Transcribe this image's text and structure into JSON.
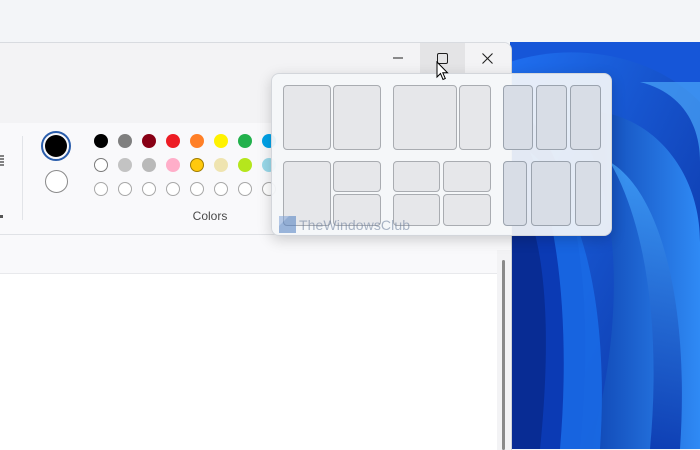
{
  "window": {
    "caption": {
      "minimize_icon": "minimize-icon",
      "maximize_icon": "maximize-icon",
      "close_icon": "close-icon"
    }
  },
  "ribbon": {
    "colors_label": "Colors",
    "primary_color": "#000000",
    "secondary_color": "#ffffff",
    "palette_row1": [
      "#000000",
      "#7f7f7f",
      "#880015",
      "#ed1c24",
      "#ff7f27",
      "#fff200",
      "#22b14c",
      "#00a2e8"
    ],
    "palette_row2": [
      "#ffffff",
      "#c3c3c3",
      "#b9b9b9",
      "#ffaec9",
      "#ffc90e",
      "#efe4b0",
      "#b5e61d",
      "#99d9ea"
    ],
    "palette_row3": [
      "#ffffff",
      "#ffffff",
      "#ffffff",
      "#ffffff",
      "#ffffff",
      "#ffffff",
      "#ffffff",
      "#ffffff"
    ]
  },
  "snap_layouts": {
    "layouts": [
      {
        "name": "two-halves",
        "zones": 2
      },
      {
        "name": "two-thirds-one-third",
        "zones": 2
      },
      {
        "name": "three-columns",
        "zones": 3
      },
      {
        "name": "half-plus-two-quarters",
        "zones": 3
      },
      {
        "name": "four-quadrants",
        "zones": 4
      },
      {
        "name": "three-columns-wide-center",
        "zones": 3
      }
    ]
  },
  "watermark": {
    "text": "TheWindowsClub"
  }
}
